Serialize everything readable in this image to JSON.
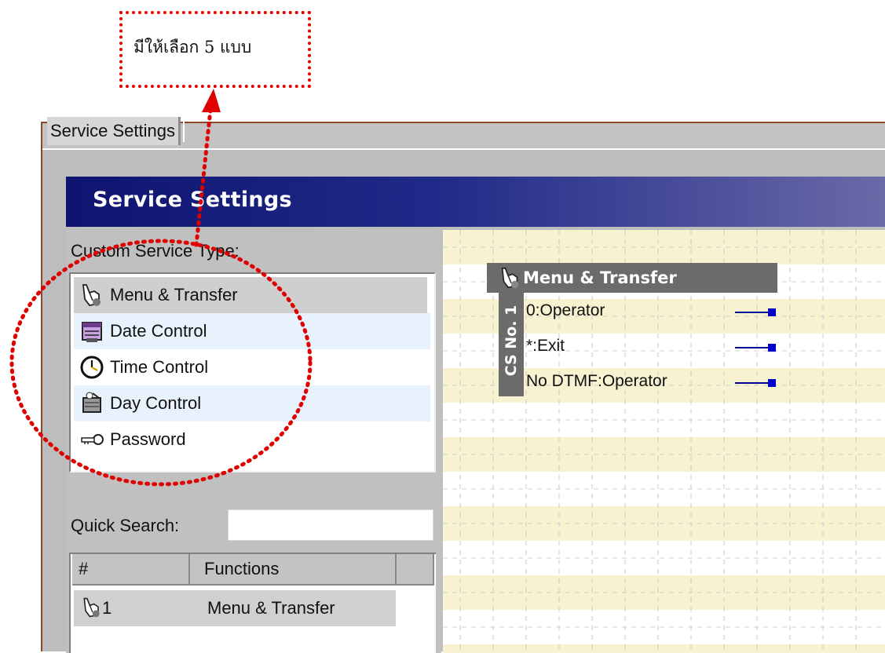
{
  "callout": {
    "text": "มีให้เลือก 5  แบบ"
  },
  "tabs": [
    {
      "label": "Service Settings"
    }
  ],
  "header": {
    "title": "Service Settings"
  },
  "left_panel": {
    "custom_type_label": "Custom Service Type:",
    "service_types": [
      {
        "label": "Menu & Transfer",
        "icon": "hand-icon"
      },
      {
        "label": "Date Control",
        "icon": "calendar-icon"
      },
      {
        "label": "Time Control",
        "icon": "clock-icon"
      },
      {
        "label": "Day Control",
        "icon": "day-icon"
      },
      {
        "label": "Password",
        "icon": "key-icon"
      }
    ],
    "quick_search_label": "Quick Search:",
    "quick_search_value": "",
    "functions_table": {
      "columns": [
        "#",
        "Functions"
      ],
      "rows": [
        {
          "number": "1",
          "function": "Menu & Transfer",
          "icon": "hand-icon"
        }
      ]
    }
  },
  "canvas": {
    "node": {
      "title": "Menu & Transfer",
      "side_label": "CS No. 1",
      "rows": [
        "0:Operator",
        "*:Exit",
        "No DTMF:Operator"
      ]
    }
  },
  "colors": {
    "annotation": "#e00000",
    "header_start": "#0e1470",
    "header_end": "#6a6aa8",
    "grid_band": "#f7f2cf",
    "port": "#0000cc"
  }
}
